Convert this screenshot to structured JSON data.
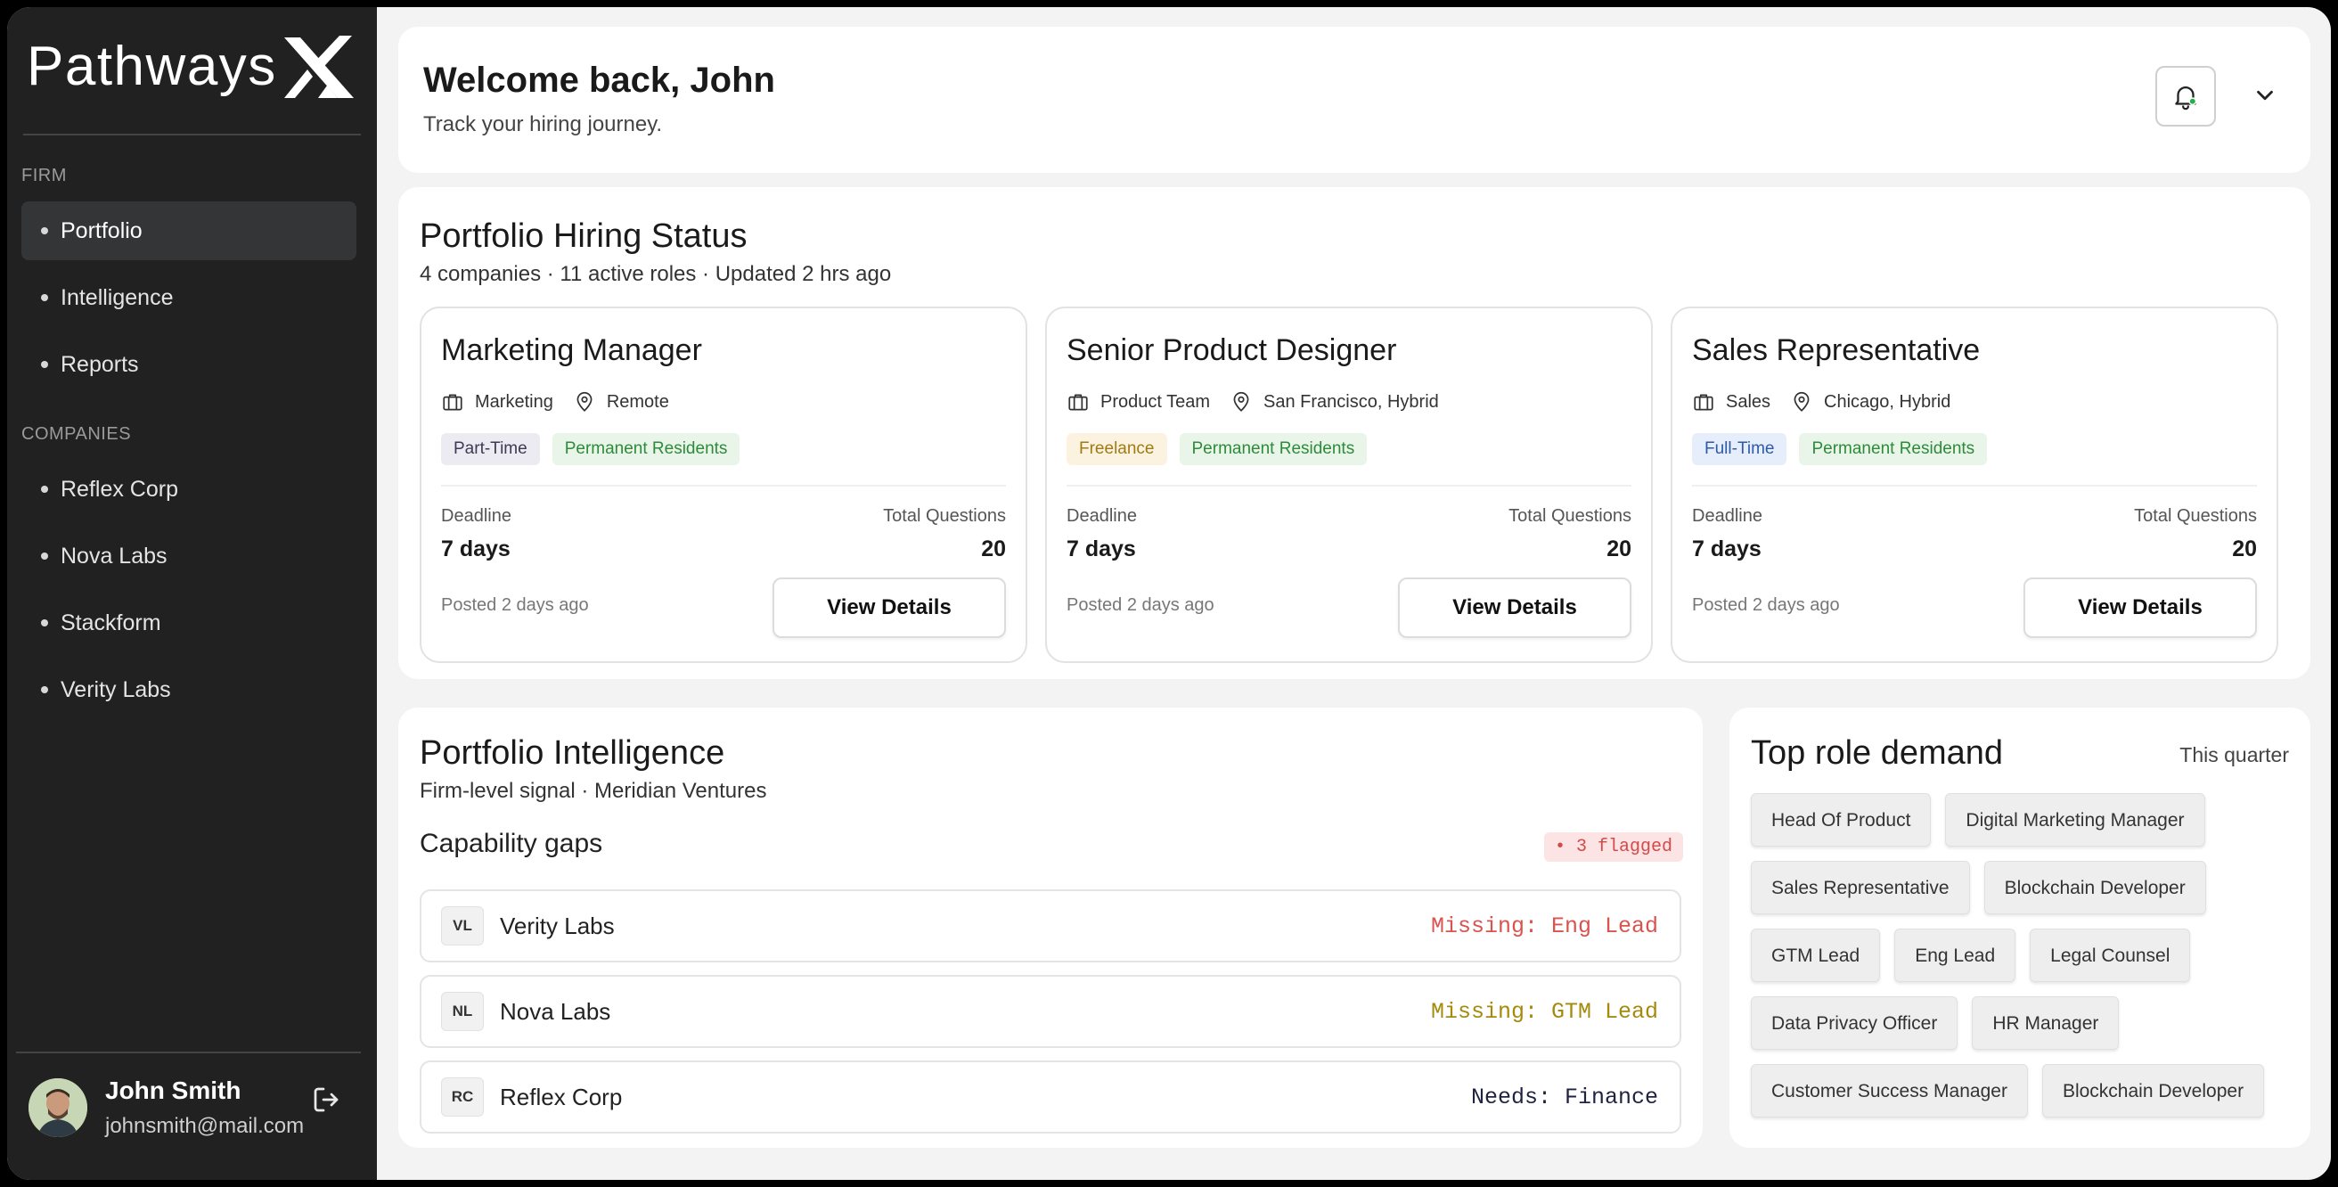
{
  "app": {
    "brand": "Pathways"
  },
  "sidebar": {
    "firm_label": "FIRM",
    "firm_items": [
      {
        "label": "Portfolio",
        "active": true
      },
      {
        "label": "Intelligence"
      },
      {
        "label": "Reports"
      }
    ],
    "companies_label": "COMPANIES",
    "company_items": [
      {
        "label": "Reflex Corp"
      },
      {
        "label": "Nova Labs"
      },
      {
        "label": "Stackform"
      },
      {
        "label": "Verity Labs"
      }
    ],
    "user": {
      "name": "John Smith",
      "email": "johnsmith@mail.com"
    }
  },
  "header": {
    "title": "Welcome back, John",
    "subtitle": "Track your hiring journey.",
    "notification_dot_color": "#22b14c"
  },
  "hiring_status": {
    "title": "Portfolio Hiring Status",
    "subtitle": "4 companies · 11 active roles · Updated 2 hrs ago",
    "jobs": [
      {
        "title": "Marketing Manager",
        "department": "Marketing",
        "location": "Remote",
        "tags": [
          "Part-Time",
          "Permanent Residents"
        ],
        "deadline_label": "Deadline",
        "deadline": "7 days",
        "questions_label": "Total Questions",
        "questions": "20",
        "posted": "Posted 2 days ago",
        "button": "View Details"
      },
      {
        "title": "Senior Product Designer",
        "department": "Product Team",
        "location": "San Francisco, Hybrid",
        "tags": [
          "Freelance",
          "Permanent Residents"
        ],
        "deadline_label": "Deadline",
        "deadline": "7 days",
        "questions_label": "Total Questions",
        "questions": "20",
        "posted": "Posted 2 days ago",
        "button": "View Details"
      },
      {
        "title": "Sales Representative",
        "department": "Sales",
        "location": "Chicago, Hybrid",
        "tags": [
          "Full-Time",
          "Permanent Residents"
        ],
        "deadline_label": "Deadline",
        "deadline": "7 days",
        "questions_label": "Total Questions",
        "questions": "20",
        "posted": "Posted 2 days ago",
        "button": "View Details"
      }
    ]
  },
  "intelligence": {
    "title": "Portfolio Intelligence",
    "subtitle": "Firm-level signal · Meridian Ventures",
    "gaps_title": "Capability gaps",
    "flag_badge": "• 3 flagged",
    "gaps": [
      {
        "initials": "VL",
        "company": "Verity Labs",
        "status": "Missing: Eng Lead",
        "color": "#d9534f"
      },
      {
        "initials": "NL",
        "company": "Nova Labs",
        "status": "Missing: GTM Lead",
        "color": "#a58a0c"
      },
      {
        "initials": "RC",
        "company": "Reflex Corp",
        "status": "Needs: Finance",
        "color": "#1f2340"
      }
    ]
  },
  "demand": {
    "title": "Top role demand",
    "period": "This quarter",
    "roles": [
      "Head Of Product",
      "Digital Marketing Manager",
      "Sales Representative",
      "Blockchain Developer",
      "GTM Lead",
      "Eng Lead",
      "Legal Counsel",
      "Data Privacy Officer",
      "HR Manager",
      "Customer Success Manager",
      "Blockchain Developer"
    ]
  },
  "tag_colors": {
    "Part-Time": {
      "bg": "#ecebf2",
      "fg": "#3c3a55"
    },
    "Freelance": {
      "bg": "#fbf3df",
      "fg": "#a07a12"
    },
    "Full-Time": {
      "bg": "#e6eefb",
      "fg": "#2e5aa8"
    },
    "Permanent Residents": {
      "bg": "#e8f5e8",
      "fg": "#2e8b3a"
    }
  }
}
